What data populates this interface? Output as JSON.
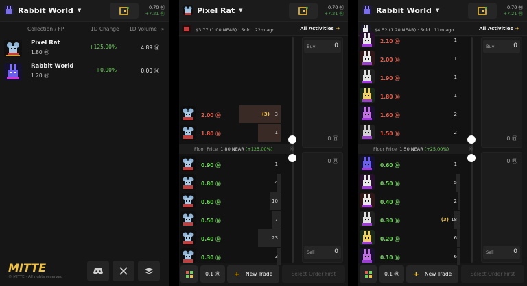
{
  "panel1": {
    "title": "Rabbit World",
    "balance": {
      "amount": "0.70 Ⓝ",
      "change": "+7.21 Ⓝ"
    },
    "headers": {
      "collection": "Collection / FP",
      "change": "1D Change",
      "volume": "1D Volume",
      "more": "»"
    },
    "rows": [
      {
        "name": "Pixel Rat",
        "fp": "1.80 Ⓝ",
        "change": "+125.00%",
        "volume": "4.89 Ⓝ"
      },
      {
        "name": "Rabbit World",
        "fp": "1.20 Ⓝ",
        "change": "+0.00%",
        "volume": "0.00 Ⓝ"
      }
    ],
    "logo_text": "MITTE",
    "copyright": "© MITTE · All rights reserved",
    "social": [
      "discord-icon",
      "x-icon",
      "stack-icon"
    ]
  },
  "panel2": {
    "title": "Pixel Rat",
    "balance": {
      "amount": "0.70 Ⓝ",
      "change": "+7.21 Ⓝ"
    },
    "last_trade": "$3.77 (1.00 NEAR) · Sold · 22m ago",
    "all_activities": "All Activities",
    "asks": [
      {
        "price": "2.00 Ⓝ",
        "count": "3",
        "own": "(3)",
        "depth": 1.0
      },
      {
        "price": "1.80 Ⓝ",
        "count": "1",
        "own": "",
        "depth": 0.55
      }
    ],
    "floor": {
      "label": "Floor Price",
      "value": "1.80 NEAR",
      "pct": "(+125.00%)"
    },
    "bids": [
      {
        "price": "0.90 Ⓝ",
        "count": "1",
        "depth": 0.0
      },
      {
        "price": "0.80 Ⓝ",
        "count": "4",
        "depth": 0.1
      },
      {
        "price": "0.60 Ⓝ",
        "count": "10",
        "depth": 0.25
      },
      {
        "price": "0.50 Ⓝ",
        "count": "7",
        "depth": 0.2
      },
      {
        "price": "0.40 Ⓝ",
        "count": "23",
        "depth": 0.55
      },
      {
        "price": "0.30 Ⓝ",
        "count": "3",
        "depth": 0.1
      }
    ],
    "buy_label": "Buy",
    "buy_value": "0",
    "buy_total": "0 Ⓝ",
    "sell_total": "0 Ⓝ",
    "sell_label": "Sell",
    "sell_value": "0",
    "qty": "0.1 Ⓝ",
    "new_trade": "New Trade",
    "submit": "Select Order First"
  },
  "panel3": {
    "title": "Rabbit World",
    "balance": {
      "amount": "0.70 Ⓝ",
      "change": "+7.21 Ⓝ"
    },
    "last_trade": "$4.52 (1.20 NEAR) · Sold · 11m ago",
    "all_activities": "All Activities",
    "asks": [
      {
        "price": "2.10 Ⓝ",
        "count": "1",
        "depth": 0.0
      },
      {
        "price": "2.00 Ⓝ",
        "count": "1",
        "depth": 0.0
      },
      {
        "price": "1.90 Ⓝ",
        "count": "1",
        "depth": 0.0
      },
      {
        "price": "1.80 Ⓝ",
        "count": "1",
        "depth": 0.0
      },
      {
        "price": "1.60 Ⓝ",
        "count": "2",
        "depth": 0.0
      },
      {
        "price": "1.50 Ⓝ",
        "count": "2",
        "depth": 0.0
      }
    ],
    "floor": {
      "label": "Floor Price",
      "value": "1.50 NEAR",
      "pct": "(+25.00%)"
    },
    "bids": [
      {
        "price": "0.60 Ⓝ",
        "count": "1",
        "own": "",
        "depth": 0.0
      },
      {
        "price": "0.50 Ⓝ",
        "count": "5",
        "own": "",
        "depth": 0.1
      },
      {
        "price": "0.40 Ⓝ",
        "count": "2",
        "own": "",
        "depth": 0.05
      },
      {
        "price": "0.30 Ⓝ",
        "count": "18",
        "own": "(3)",
        "depth": 0.15
      },
      {
        "price": "0.20 Ⓝ",
        "count": "6",
        "own": "",
        "depth": 0.07
      },
      {
        "price": "0.10 Ⓝ",
        "count": "6",
        "own": "",
        "depth": 0.07
      }
    ],
    "buy_label": "Buy",
    "buy_value": "0",
    "buy_total": "0 Ⓝ",
    "sell_total": "0 Ⓝ",
    "sell_label": "Sell",
    "sell_value": "0",
    "qty": "0.1 Ⓝ",
    "new_trade": "New Trade",
    "submit": "Select Order First"
  },
  "colors": {
    "ask": "#e06050",
    "bid": "#6fd35c",
    "accent": "#f0c040",
    "bg": "#161616"
  }
}
